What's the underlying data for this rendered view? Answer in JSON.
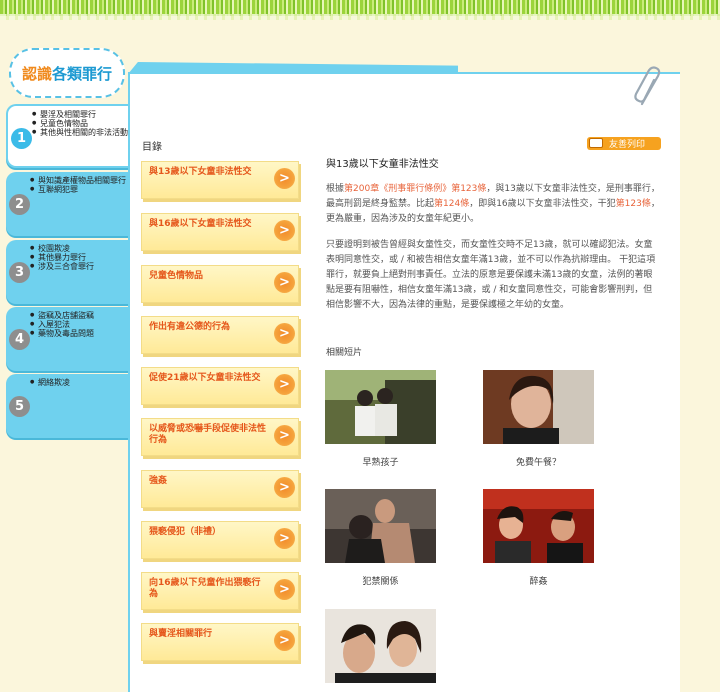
{
  "section_title": {
    "part1": "認識",
    "part2": "各類罪行"
  },
  "tabs": [
    {
      "number": "1",
      "items": [
        "嬰淫及相關罪行",
        "兒童色情物品",
        "其他與性相關的非法活動"
      ]
    },
    {
      "number": "2",
      "items": [
        "與知識產權物品相關罪行",
        "互聯網犯罪"
      ]
    },
    {
      "number": "3",
      "items": [
        "校園欺凌",
        "其他暴力罪行",
        "涉及三合會罪行"
      ]
    },
    {
      "number": "4",
      "items": [
        "盜竊及店舖盜竊",
        "入屋犯法",
        "藥物及毒品問題"
      ]
    },
    {
      "number": "5",
      "items": [
        "網絡欺凌"
      ]
    }
  ],
  "toc_label": "目錄",
  "print_label": "友善列印",
  "toc_items": [
    "與13歲以下女童非法性交",
    "與16歲以下女童非法性交",
    "兒童色情物品",
    "作出有違公德的行為",
    "促使21歲以下女童非法性交",
    "以威脅或恐嚇手段促使非法性行為",
    "強姦",
    "猥褻侵犯（非禮）",
    "向16歲以下兒童作出猥褻行為",
    "與賣淫相關罪行"
  ],
  "article": {
    "title": "與13歲以下女童非法性交",
    "p1_a": "根據",
    "p1_link1": "第200章《刑事罪行條例》第123條",
    "p1_b": "，與13歲以下女童非法性交，是刑事罪行，最高刑罰是終身監禁。比起",
    "p1_link2": "第124條",
    "p1_c": "，即與16歲以下女童非法性交，干犯",
    "p1_link3": "第123條",
    "p1_d": "，更為嚴重，因為涉及的女童年紀更小。",
    "p2": "只要證明到被告曾經與女童性交，而女童性交時不足13歲，就可以確認犯法。女童表明同意性交，或 / 和被告相信女童年滿13歲，並不可以作為抗辯理由。 干犯這項罪行，就要負上絕對刑事責任。立法的原意是要保護未滿13歲的女童，法例的著眼點是要有阻嚇性，相信女童年滿13歲，或 / 和女童同意性交，可能會影響刑判，但相信影響不大，因為法律的重點，是要保護極之年幼的女童。",
    "videos_label": "相關短片"
  },
  "videos": [
    {
      "caption": "早熟孩子"
    },
    {
      "caption": "免費午餐？"
    },
    {
      "caption": "犯禁關係"
    },
    {
      "caption": "醉姦"
    },
    {
      "caption": ""
    }
  ],
  "colors": {
    "accent_blue": "#6fd1ee",
    "accent_orange": "#f6a21f",
    "link_red": "#e8643b"
  }
}
